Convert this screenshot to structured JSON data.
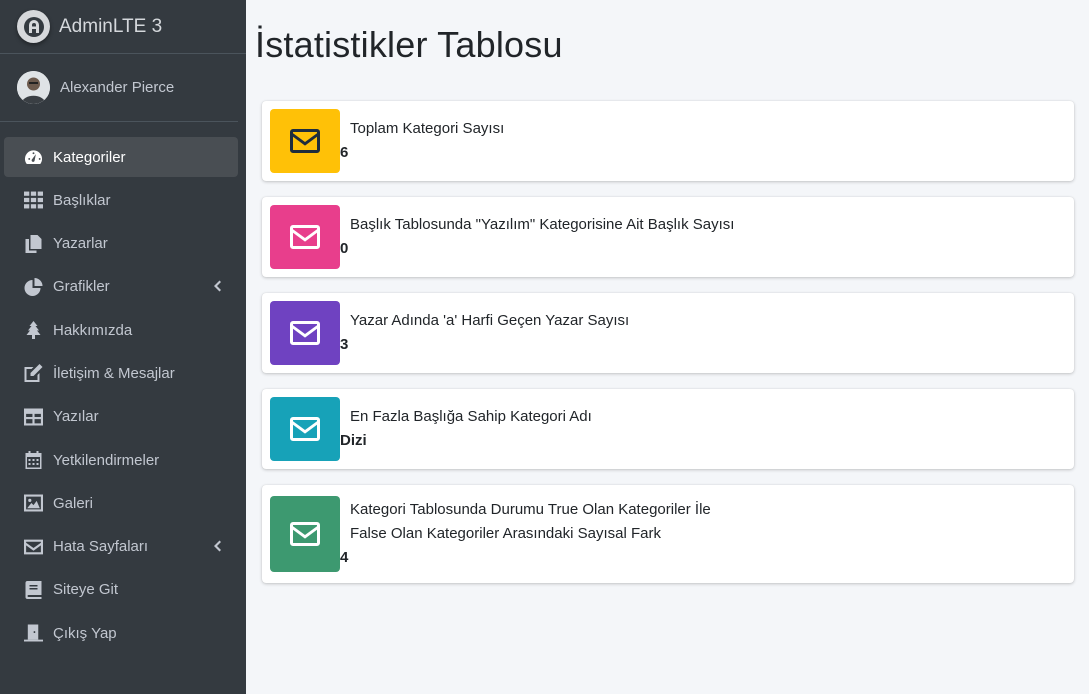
{
  "brand": {
    "title": "AdminLTE 3"
  },
  "user": {
    "name": "Alexander Pierce"
  },
  "sidebar": {
    "items": [
      {
        "label": "Kategoriler",
        "icon": "tachometer-icon",
        "active": true
      },
      {
        "label": "Başlıklar",
        "icon": "grid-icon"
      },
      {
        "label": "Yazarlar",
        "icon": "copy-icon"
      },
      {
        "label": "Grafikler",
        "icon": "pie-chart-icon",
        "has_children": true
      },
      {
        "label": "Hakkımızda",
        "icon": "tree-icon"
      },
      {
        "label": "İletişim & Mesajlar",
        "icon": "edit-icon"
      },
      {
        "label": "Yazılar",
        "icon": "table-icon"
      },
      {
        "label": "Yetkilendirmeler",
        "icon": "calendar-icon"
      },
      {
        "label": "Galeri",
        "icon": "image-icon"
      },
      {
        "label": "Hata Sayfaları",
        "icon": "envelope-icon",
        "has_children": true
      },
      {
        "label": "Siteye Git",
        "icon": "book-icon"
      },
      {
        "label": "Çıkış Yap",
        "icon": "door-icon"
      }
    ]
  },
  "main": {
    "title": "İstatistikler Tablosu",
    "boxes": [
      {
        "text": "Toplam Kategori Sayısı",
        "number": "6",
        "color": "#ffc107",
        "icon_color": "#1f2d3d"
      },
      {
        "text": "Başlık Tablosunda \"Yazılım\" Kategorisine Ait Başlık Sayısı",
        "number": "0",
        "color": "#e83e8c",
        "icon_color": "#ffffff"
      },
      {
        "text": "Yazar Adında 'a' Harfi Geçen Yazar Sayısı",
        "number": "3",
        "color": "#6f42c1",
        "icon_color": "#ffffff"
      },
      {
        "text": "En Fazla Başlığa Sahip Kategori Adı",
        "number": "Dizi",
        "color": "#17a2b8",
        "icon_color": "#ffffff"
      },
      {
        "text": "Kategori Tablosunda Durumu True Olan Kategoriler İle False Olan Kategoriler Arasındaki Sayısal Fark",
        "number": "4",
        "color": "#3d9970",
        "icon_color": "#ffffff"
      }
    ]
  }
}
